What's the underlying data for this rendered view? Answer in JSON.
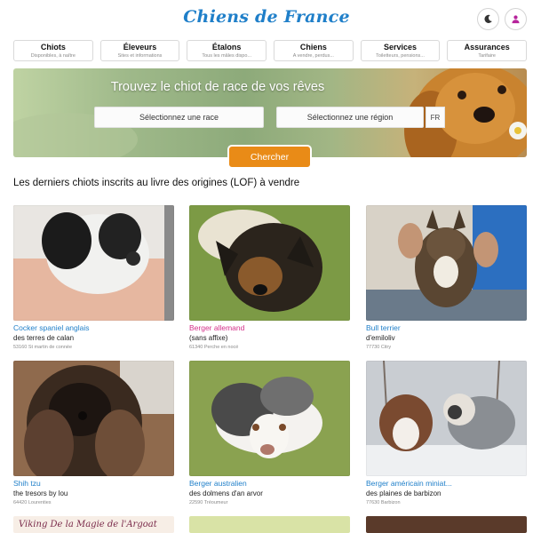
{
  "header": {
    "logo_text": "Chiens de France",
    "theme_icon": "moon-icon",
    "user_icon": "user-icon",
    "accent_color": "#1f7fc9",
    "user_icon_color": "#b6239b"
  },
  "nav": {
    "items": [
      {
        "label": "Chiots",
        "sub": "Disponibles, à naître"
      },
      {
        "label": "Éleveurs",
        "sub": "Sites et informations"
      },
      {
        "label": "Étalons",
        "sub": "Tous les mâles dispo..."
      },
      {
        "label": "Chiens",
        "sub": "A vendre, perdus..."
      },
      {
        "label": "Services",
        "sub": "Toiletteurs, pensions..."
      },
      {
        "label": "Assurances",
        "sub": "Tarifaire"
      }
    ]
  },
  "hero": {
    "title": "Trouvez le chiot de race de vos rêves",
    "race_select": "Sélectionnez une race",
    "region_select": "Sélectionnez une région",
    "lang": "FR",
    "search_button": "Chercher",
    "button_color": "#e98b17"
  },
  "listing": {
    "title": "Les derniers chiots inscrits au livre des origines (LOF) à vendre",
    "cards": [
      {
        "breed": "Cocker spaniel anglais",
        "affix": "des terres de calan",
        "location": "53160 St martin de connée"
      },
      {
        "breed": "Berger allemand",
        "affix": "(sans affixe)",
        "location": "61340 Perche en nocé"
      },
      {
        "breed": "Bull terrier",
        "affix": "d'emiloliv",
        "location": "77730 Citry"
      },
      {
        "breed": "Shih tzu",
        "affix": "the tresors by lou",
        "location": "64420 Lourenties"
      },
      {
        "breed": "Berger australien",
        "affix": "des dolmens d'an arvor",
        "location": "22590 Tréoumeur"
      },
      {
        "breed": "Berger américain miniat...",
        "affix": "des plaines de barbizon",
        "location": "77630 Barbizon"
      }
    ],
    "partial_card_text": "Viking De la Magie de l'Argoat"
  }
}
